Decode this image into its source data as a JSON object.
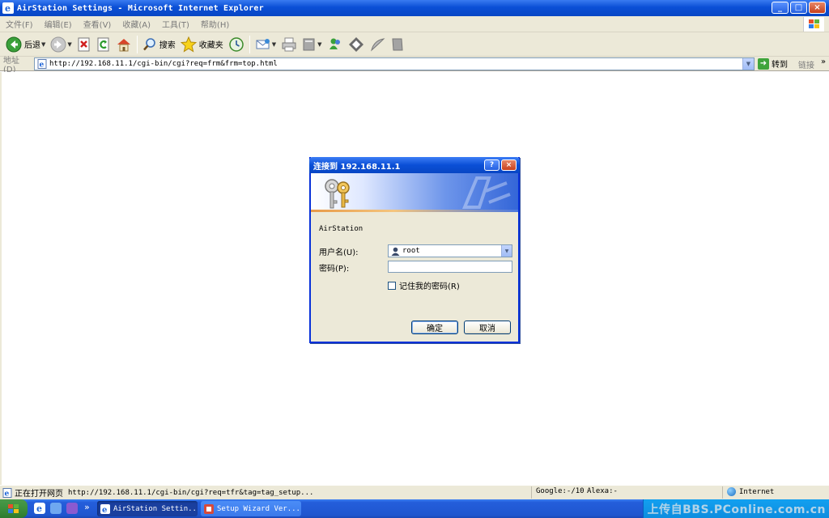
{
  "window": {
    "title": "AirStation Settings - Microsoft Internet Explorer",
    "minimize": "_",
    "maximize": "□",
    "close": "×"
  },
  "menu": [
    "文件(F)",
    "编辑(E)",
    "查看(V)",
    "收藏(A)",
    "工具(T)",
    "帮助(H)"
  ],
  "toolbar": {
    "back_label": "后退",
    "search_label": "搜索",
    "favorites_label": "收藏夹"
  },
  "address": {
    "label": "地址(D)",
    "url": "http://192.168.11.1/cgi-bin/cgi?req=frm&frm=top.html",
    "go_label": "转到",
    "links_label": "链接",
    "links_more": "»"
  },
  "dialog": {
    "title": "连接到 192.168.11.1",
    "help": "?",
    "close": "×",
    "realm": "AirStation",
    "username_label": "用户名(U):",
    "username_value": "root",
    "password_label": "密码(P):",
    "password_value": "",
    "remember_label": "记住我的密码(R)",
    "remember_checked": false,
    "ok_label": "确定",
    "cancel_label": "取消"
  },
  "status": {
    "message": "正在打开网页",
    "url": "http://192.168.11.1/cgi-bin/cgi?req=tfr&tag=tag_setup...",
    "google": "Google:-/10",
    "alexa": "Alexa:-",
    "zone": "Internet"
  },
  "taskbar": {
    "more": "»",
    "tasks": [
      {
        "label": "AirStation Settin..."
      },
      {
        "label": "Setup Wizard  Ver..."
      }
    ],
    "watermark": "上传自BBS.PConline.com.cn"
  },
  "colors": {
    "xp_blue": "#0a4fd6",
    "dialog_face": "#ece9d8",
    "taskbar": "#245edb"
  }
}
